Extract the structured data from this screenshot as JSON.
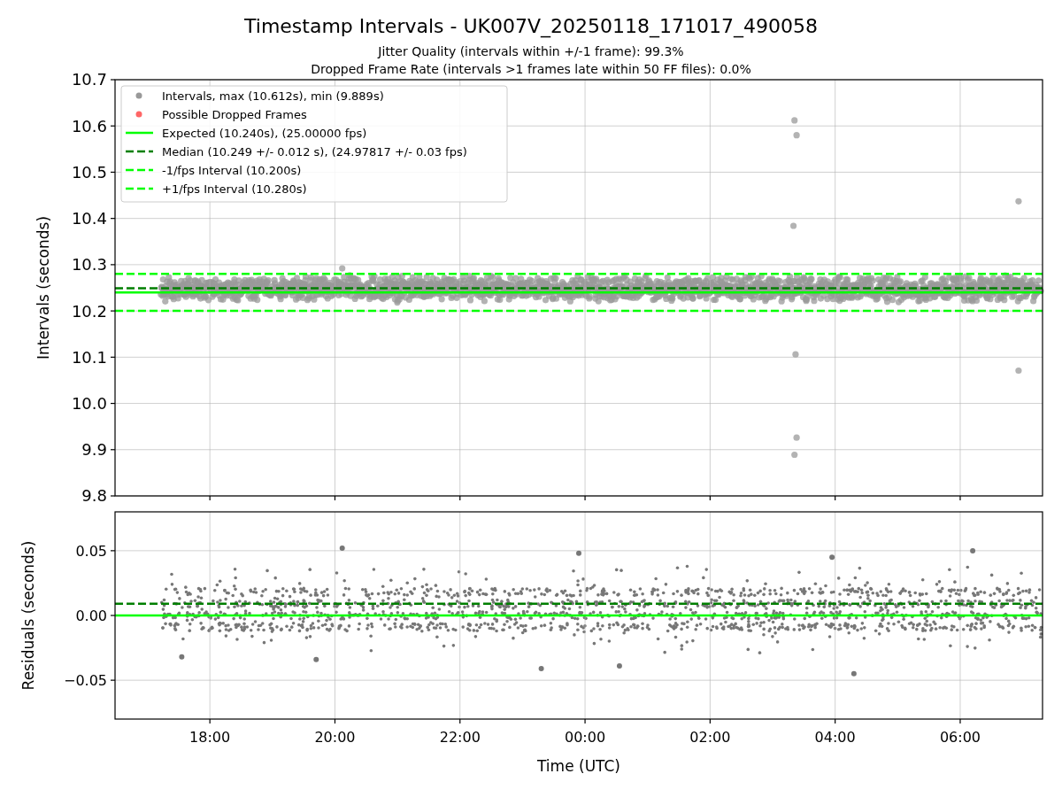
{
  "figure": {
    "title": "Timestamp Intervals - UK007V_20250118_171017_490058",
    "subtitles": [
      "Jitter Quality (intervals within +/-1 frame): 99.3%",
      "Dropped Frame Rate (intervals >1 frames late within 50 FF files): 0.0%"
    ]
  },
  "intervals_panel": {
    "legend": [
      {
        "label": "Intervals, max (10.612s), min (9.889s)",
        "kind": "marker",
        "color": "#999999"
      },
      {
        "label": "Possible Dropped Frames",
        "kind": "marker",
        "color": "#ff6666"
      },
      {
        "label": "Expected (10.240s), (25.00000 fps)",
        "kind": "solid",
        "color": "#00ff00"
      },
      {
        "label": "Median (10.249 +/- 0.012 s), (24.97817 +/- 0.03 fps)",
        "kind": "dashed",
        "color": "#007f00"
      },
      {
        "label": "-1/fps Interval (10.200s)",
        "kind": "dashed",
        "color": "#00ff00"
      },
      {
        "label": "+1/fps Interval (10.280s)",
        "kind": "dashed",
        "color": "#00ff00"
      }
    ],
    "chart_data": {
      "type": "scatter",
      "ylabel": "Intervals (seconds)",
      "grid": true,
      "x": [
        "2025-01-18 20:07",
        "2025-01-19 03:21",
        "2025-01-19 03:23",
        "2025-01-19 03:20",
        "2025-01-19 03:22",
        "2025-01-19 03:23",
        "2025-01-19 03:21",
        "2025-01-19 06:56",
        "2025-01-19 06:56"
      ],
      "series": [
        {
          "color": "#999999",
          "values": [
            10.292,
            10.612,
            10.58,
            10.384,
            10.106,
            9.926,
            9.889,
            10.437,
            10.071
          ]
        }
      ],
      "ref_lines": [
        {
          "axis": "y",
          "value": 10.24,
          "color": "#00ff00"
        },
        {
          "axis": "y",
          "value": 10.249,
          "color": "#007f00"
        },
        {
          "axis": "y",
          "value": 10.2,
          "color": "#00ff00"
        },
        {
          "axis": "y",
          "value": 10.28,
          "color": "#00ff00"
        }
      ],
      "xlim": [
        "2025-01-18 16:29",
        "2025-01-19 07:19"
      ],
      "ylim": [
        9.8,
        10.7
      ],
      "yticks": [
        {
          "value": 9.8,
          "label": "9.8"
        },
        {
          "value": 9.9,
          "label": "9.9"
        },
        {
          "value": 10.0,
          "label": "10.0"
        },
        {
          "value": 10.1,
          "label": "10.1"
        },
        {
          "value": 10.2,
          "label": "10.2"
        },
        {
          "value": 10.3,
          "label": "10.3"
        },
        {
          "value": 10.4,
          "label": "10.4"
        },
        {
          "value": 10.5,
          "label": "10.5"
        },
        {
          "value": 10.6,
          "label": "10.6"
        },
        {
          "value": 10.7,
          "label": "10.7"
        }
      ]
    }
  },
  "residuals_panel": {
    "chart_data": {
      "type": "scatter",
      "xlabel": "Time (UTC)",
      "ylabel": "Residuals (seconds)",
      "grid": true,
      "x": [
        "2025-01-18 20:07",
        "2025-01-19 06:12",
        "2025-01-19 04:18",
        "2025-01-18 23:18",
        "2025-01-18 19:42",
        "2025-01-19 00:33",
        "2025-01-18 17:33",
        "2025-01-18 23:54",
        "2025-01-19 03:57"
      ],
      "series": [
        {
          "color": "#777777",
          "values": [
            0.052,
            0.05,
            -0.045,
            -0.041,
            -0.034,
            -0.039,
            -0.032,
            0.048,
            0.045
          ]
        }
      ],
      "ref_lines": [
        {
          "axis": "y",
          "value": 0.009,
          "color": "#007f00"
        },
        {
          "axis": "y",
          "value": 0.0,
          "color": "#00ff00"
        }
      ],
      "xlim": [
        "2025-01-18 16:29",
        "2025-01-19 07:19"
      ],
      "ylim": [
        -0.08,
        0.08
      ],
      "xticks": [
        {
          "value": "2025-01-18 18:00",
          "label": "18:00"
        },
        {
          "value": "2025-01-18 20:00",
          "label": "20:00"
        },
        {
          "value": "2025-01-18 22:00",
          "label": "22:00"
        },
        {
          "value": "2025-01-19 00:00",
          "label": "00:00"
        },
        {
          "value": "2025-01-19 02:00",
          "label": "02:00"
        },
        {
          "value": "2025-01-19 04:00",
          "label": "04:00"
        },
        {
          "value": "2025-01-19 06:00",
          "label": "06:00"
        }
      ],
      "yticks": [
        {
          "value": -0.05,
          "label": "−0.05"
        },
        {
          "value": 0.0,
          "label": "0.00"
        },
        {
          "value": 0.05,
          "label": "0.05"
        }
      ]
    }
  }
}
